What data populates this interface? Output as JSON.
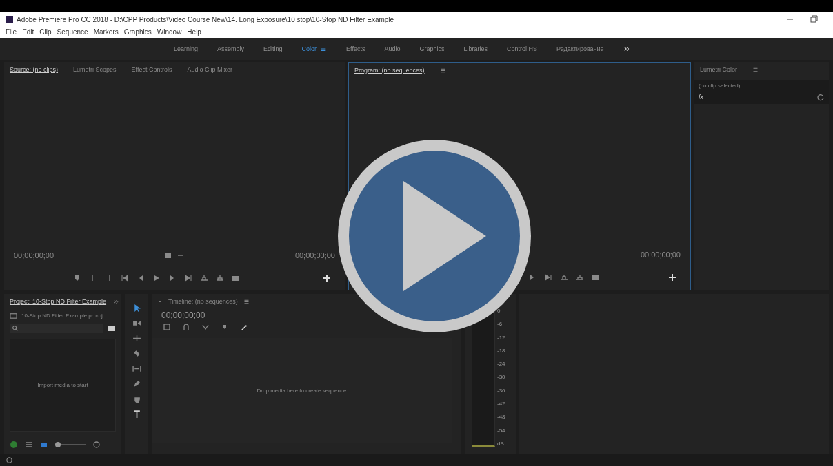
{
  "window": {
    "title": "Adobe Premiere Pro CC 2018 - D:\\CPP Products\\Video Course New\\14. Long Exposure\\10 stop\\10-Stop ND Filter Example"
  },
  "menu": [
    "File",
    "Edit",
    "Clip",
    "Sequence",
    "Markers",
    "Graphics",
    "Window",
    "Help"
  ],
  "workspaces": [
    {
      "label": "Learning",
      "selected": false
    },
    {
      "label": "Assembly",
      "selected": false
    },
    {
      "label": "Editing",
      "selected": false
    },
    {
      "label": "Color",
      "selected": true
    },
    {
      "label": "Effects",
      "selected": false
    },
    {
      "label": "Audio",
      "selected": false
    },
    {
      "label": "Graphics",
      "selected": false
    },
    {
      "label": "Libraries",
      "selected": false
    },
    {
      "label": "Control HS",
      "selected": false
    },
    {
      "label": "Редактирование",
      "selected": false
    }
  ],
  "source_panel": {
    "tabs": [
      {
        "label": "Source: (no clips)",
        "selected": true
      },
      {
        "label": "Lumetri Scopes",
        "selected": false
      },
      {
        "label": "Effect Controls",
        "selected": false
      },
      {
        "label": "Audio Clip Mixer",
        "selected": false
      }
    ],
    "timecode_left": "00;00;00;00",
    "timecode_right": "00;00;00;00"
  },
  "program_panel": {
    "title": "Program: (no sequences)",
    "timecode_right": "00;00;00;00"
  },
  "lumetri_panel": {
    "title": "Lumetri Color",
    "clip": "(no clip selected)",
    "fx": "fx"
  },
  "project_panel": {
    "title": "Project: 10-Stop ND Filter Example",
    "file": "10-Stop ND Filter Example.prproj",
    "empty_text": "Import media to start",
    "zoom": {
      "level": 0.1
    }
  },
  "timeline_panel": {
    "title": "Timeline: (no sequences)",
    "timecode": "00;00;00;00",
    "empty_text": "Drop media here to create sequence"
  },
  "audio_meter": {
    "scale": [
      "0",
      "-6",
      "-12",
      "-18",
      "-24",
      "-30",
      "-36",
      "-42",
      "-48",
      "-54",
      "dB"
    ]
  }
}
